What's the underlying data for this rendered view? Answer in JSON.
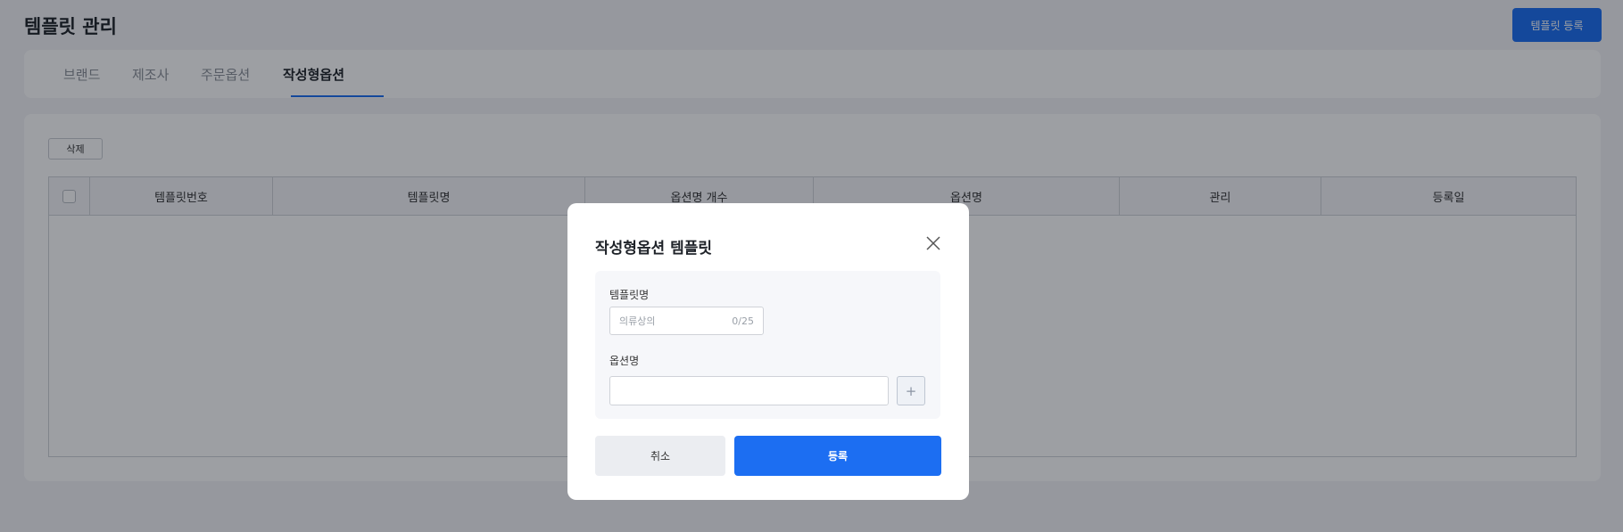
{
  "header": {
    "title": "템플릿 관리",
    "register_label": "템플릿 등록"
  },
  "tabs": [
    {
      "label": "브랜드",
      "active": false
    },
    {
      "label": "제조사",
      "active": false
    },
    {
      "label": "주문옵션",
      "active": false
    },
    {
      "label": "작성형옵션",
      "active": true
    }
  ],
  "toolbar": {
    "delete_label": "삭제"
  },
  "table": {
    "columns": [
      "템플릿번호",
      "템플릿명",
      "옵션명 개수",
      "옵션명",
      "관리",
      "등록일"
    ],
    "rows": []
  },
  "modal": {
    "title": "작성형옵션 템플릿",
    "name_label": "템플릿명",
    "name_placeholder": "의류상의",
    "name_counter": "0/25",
    "option_label": "옵션명",
    "option_value": "",
    "add_symbol": "+",
    "cancel_label": "취소",
    "submit_label": "등록"
  },
  "colors": {
    "accent": "#1c6ef2",
    "overlay": "rgba(10,14,26,0.40)"
  }
}
